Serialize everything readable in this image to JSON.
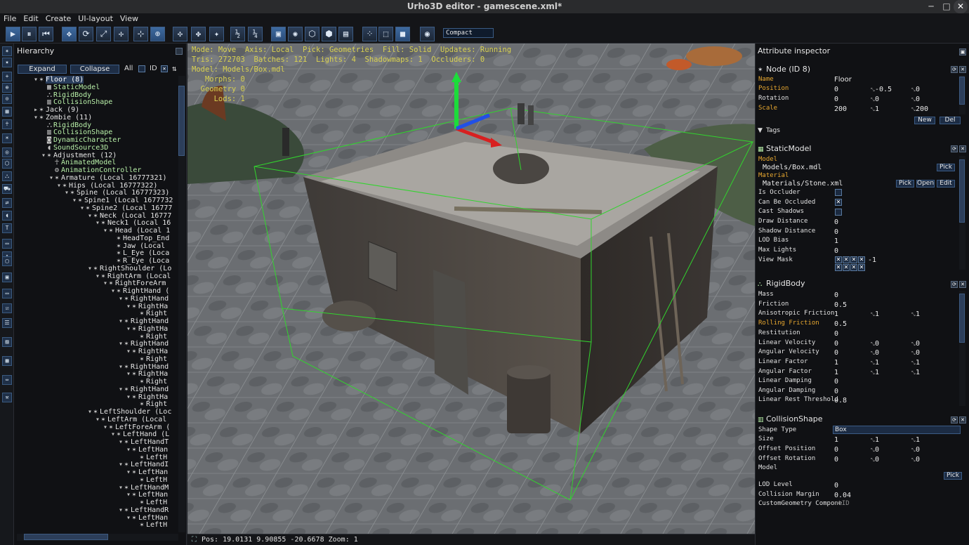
{
  "window": {
    "title": "Urho3D editor - gamescene.xml*"
  },
  "menu": [
    "File",
    "Edit",
    "Create",
    "UI-layout",
    "View"
  ],
  "toolbar": {
    "mode_select": "Compact",
    "buttons": [
      {
        "name": "play-icon",
        "glyph": "▶"
      },
      {
        "name": "pause-icon",
        "glyph": "⏸"
      },
      {
        "name": "rewind-icon",
        "glyph": "⏮"
      },
      {
        "name": "move-icon",
        "glyph": "✥"
      },
      {
        "name": "rotate-icon",
        "glyph": "⟳"
      },
      {
        "name": "scale-icon",
        "glyph": "⤢"
      },
      {
        "name": "select-icon",
        "glyph": "✢"
      },
      {
        "name": "local-axis-icon",
        "glyph": "⊹"
      },
      {
        "name": "world-axis-icon",
        "glyph": "⊕"
      },
      {
        "name": "snap-move-icon",
        "glyph": "✣"
      },
      {
        "name": "snap-rotate-icon",
        "glyph": "✤"
      },
      {
        "name": "snap-scale-icon",
        "glyph": "✦"
      },
      {
        "name": "snap-half-icon",
        "glyph": "½"
      },
      {
        "name": "snap-quarter-icon",
        "glyph": "¼"
      },
      {
        "name": "pick-geometry-icon",
        "glyph": "▣"
      },
      {
        "name": "pick-lights-icon",
        "glyph": "✺"
      },
      {
        "name": "pick-zones-icon",
        "glyph": "⬡"
      },
      {
        "name": "pick-rigidbodies-icon",
        "glyph": "⬢"
      },
      {
        "name": "pick-ui-icon",
        "glyph": "▤"
      },
      {
        "name": "fill-point-icon",
        "glyph": "⁘"
      },
      {
        "name": "fill-wireframe-icon",
        "glyph": "⬚"
      },
      {
        "name": "fill-solid-icon",
        "glyph": "■"
      },
      {
        "name": "camera-view-icon",
        "glyph": "◉"
      }
    ]
  },
  "leftbar_icons": [
    "node-icon",
    "component-icon",
    "new-node-icon",
    "new-replicated-icon",
    "new-local-icon",
    "geometry-icon",
    "animation-icon",
    "light-icon",
    "camera-icon",
    "zone-icon",
    "physics-icon",
    "navigation-icon",
    "network-icon",
    "audio-icon",
    "text-icon",
    "ui-icon",
    "scroll-icon",
    "button-icon",
    "window-icon",
    "lineedit-icon",
    "checkbox-icon",
    "list-icon",
    "sprite-icon",
    "border-icon",
    "slider-icon",
    "tool-icon"
  ],
  "hierarchy": {
    "title": "Hierarchy",
    "expand_label": "Expand",
    "collapse_label": "Collapse",
    "all_label": "All",
    "id_label": "ID",
    "rows": [
      {
        "indent": 4,
        "exp": "▼",
        "icon": "✶",
        "text": "Floor (8)",
        "comp": false,
        "sel": true
      },
      {
        "indent": 5,
        "exp": "",
        "icon": "▦",
        "text": "StaticModel",
        "comp": true
      },
      {
        "indent": 5,
        "exp": "",
        "icon": "⛬",
        "text": "RigidBody",
        "comp": true
      },
      {
        "indent": 5,
        "exp": "",
        "icon": "▥",
        "text": "CollisionShape",
        "comp": true
      },
      {
        "indent": 4,
        "exp": "▶",
        "icon": "✶",
        "text": "Jack (9)",
        "comp": false
      },
      {
        "indent": 4,
        "exp": "▼",
        "icon": "✶",
        "text": "Zombie (11)",
        "comp": false
      },
      {
        "indent": 5,
        "exp": "",
        "icon": "⛬",
        "text": "RigidBody",
        "comp": true
      },
      {
        "indent": 5,
        "exp": "",
        "icon": "▥",
        "text": "CollisionShape",
        "comp": true
      },
      {
        "indent": 5,
        "exp": "",
        "icon": "◙",
        "text": "DynamicCharacter",
        "comp": true
      },
      {
        "indent": 5,
        "exp": "",
        "icon": "◖",
        "text": "SoundSource3D",
        "comp": true
      },
      {
        "indent": 5,
        "exp": "▼",
        "icon": "✶",
        "text": "Adjustment (12)",
        "comp": false
      },
      {
        "indent": 6,
        "exp": "",
        "icon": "☥",
        "text": "AnimatedModel",
        "comp": true
      },
      {
        "indent": 6,
        "exp": "",
        "icon": "⚙",
        "text": "AnimationController",
        "comp": true
      },
      {
        "indent": 6,
        "exp": "▼",
        "icon": "✶",
        "text": "Armature (Local 16777321)",
        "comp": false
      },
      {
        "indent": 7,
        "exp": "▼",
        "icon": "✶",
        "text": "Hips (Local 16777322)",
        "comp": false
      },
      {
        "indent": 8,
        "exp": "▼",
        "icon": "✶",
        "text": "Spine (Local 16777323)",
        "comp": false
      },
      {
        "indent": 9,
        "exp": "▼",
        "icon": "✶",
        "text": "Spine1 (Local 1677732",
        "comp": false
      },
      {
        "indent": 10,
        "exp": "▼",
        "icon": "✶",
        "text": "Spine2 (Local 16777",
        "comp": false
      },
      {
        "indent": 11,
        "exp": "▼",
        "icon": "✶",
        "text": "Neck (Local 16777",
        "comp": false
      },
      {
        "indent": 12,
        "exp": "▼",
        "icon": "✶",
        "text": "Neck1 (Local 16",
        "comp": false
      },
      {
        "indent": 13,
        "exp": "▼",
        "icon": "✶",
        "text": "Head (Local 1",
        "comp": false
      },
      {
        "indent": 14,
        "exp": "",
        "icon": "✶",
        "text": "HeadTop_End",
        "comp": false
      },
      {
        "indent": 14,
        "exp": "",
        "icon": "✶",
        "text": "Jaw (Local",
        "comp": false
      },
      {
        "indent": 14,
        "exp": "",
        "icon": "✶",
        "text": "L_Eye (Loca",
        "comp": false
      },
      {
        "indent": 14,
        "exp": "",
        "icon": "✶",
        "text": "R_Eye (Loca",
        "comp": false
      },
      {
        "indent": 11,
        "exp": "▼",
        "icon": "✶",
        "text": "RightShoulder (Lo",
        "comp": false
      },
      {
        "indent": 12,
        "exp": "▼",
        "icon": "✶",
        "text": "RightArm (Local",
        "comp": false
      },
      {
        "indent": 13,
        "exp": "▼",
        "icon": "✶",
        "text": "RightForeArm",
        "comp": false
      },
      {
        "indent": 14,
        "exp": "▼",
        "icon": "✶",
        "text": "RightHand (",
        "comp": false
      },
      {
        "indent": 15,
        "exp": "▼",
        "icon": "✶",
        "text": "RightHand",
        "comp": false
      },
      {
        "indent": 16,
        "exp": "▼",
        "icon": "✶",
        "text": "RightHa",
        "comp": false
      },
      {
        "indent": 17,
        "exp": "",
        "icon": "✶",
        "text": "Right",
        "comp": false
      },
      {
        "indent": 15,
        "exp": "▼",
        "icon": "✶",
        "text": "RightHand",
        "comp": false
      },
      {
        "indent": 16,
        "exp": "▼",
        "icon": "✶",
        "text": "RightHa",
        "comp": false
      },
      {
        "indent": 17,
        "exp": "",
        "icon": "✶",
        "text": "Right",
        "comp": false
      },
      {
        "indent": 15,
        "exp": "▼",
        "icon": "✶",
        "text": "RightHand",
        "comp": false
      },
      {
        "indent": 16,
        "exp": "▼",
        "icon": "✶",
        "text": "RightHa",
        "comp": false
      },
      {
        "indent": 17,
        "exp": "",
        "icon": "✶",
        "text": "Right",
        "comp": false
      },
      {
        "indent": 15,
        "exp": "▼",
        "icon": "✶",
        "text": "RightHand",
        "comp": false
      },
      {
        "indent": 16,
        "exp": "▼",
        "icon": "✶",
        "text": "RightHa",
        "comp": false
      },
      {
        "indent": 17,
        "exp": "",
        "icon": "✶",
        "text": "Right",
        "comp": false
      },
      {
        "indent": 15,
        "exp": "▼",
        "icon": "✶",
        "text": "RightHand",
        "comp": false
      },
      {
        "indent": 16,
        "exp": "▼",
        "icon": "✶",
        "text": "RightHa",
        "comp": false
      },
      {
        "indent": 17,
        "exp": "",
        "icon": "✶",
        "text": "Right",
        "comp": false
      },
      {
        "indent": 11,
        "exp": "▼",
        "icon": "✶",
        "text": "LeftShoulder (Loc",
        "comp": false
      },
      {
        "indent": 12,
        "exp": "▼",
        "icon": "✶",
        "text": "LeftArm (Local",
        "comp": false
      },
      {
        "indent": 13,
        "exp": "▼",
        "icon": "✶",
        "text": "LeftForeArm (",
        "comp": false
      },
      {
        "indent": 14,
        "exp": "▼",
        "icon": "✶",
        "text": "LeftHand (L",
        "comp": false
      },
      {
        "indent": 15,
        "exp": "▼",
        "icon": "✶",
        "text": "LeftHandT",
        "comp": false
      },
      {
        "indent": 16,
        "exp": "▼",
        "icon": "✶",
        "text": "LeftHan",
        "comp": false
      },
      {
        "indent": 17,
        "exp": "",
        "icon": "✶",
        "text": "LeftH",
        "comp": false
      },
      {
        "indent": 15,
        "exp": "▼",
        "icon": "✶",
        "text": "LeftHandI",
        "comp": false
      },
      {
        "indent": 16,
        "exp": "▼",
        "icon": "✶",
        "text": "LeftHan",
        "comp": false
      },
      {
        "indent": 17,
        "exp": "",
        "icon": "✶",
        "text": "LeftH",
        "comp": false
      },
      {
        "indent": 15,
        "exp": "▼",
        "icon": "✶",
        "text": "LeftHandM",
        "comp": false
      },
      {
        "indent": 16,
        "exp": "▼",
        "icon": "✶",
        "text": "LeftHan",
        "comp": false
      },
      {
        "indent": 17,
        "exp": "",
        "icon": "✶",
        "text": "LeftH",
        "comp": false
      },
      {
        "indent": 15,
        "exp": "▼",
        "icon": "✶",
        "text": "LeftHandR",
        "comp": false
      },
      {
        "indent": 16,
        "exp": "▼",
        "icon": "✶",
        "text": "LeftHan",
        "comp": false
      },
      {
        "indent": 17,
        "exp": "",
        "icon": "✶",
        "text": "LeftH",
        "comp": false
      }
    ]
  },
  "viewport": {
    "stats_line1": "Mode: Move  Axis: Local  Pick: Geometries  Fill: Solid  Updates: Running",
    "stats_line2": "Tris: 272703  Batches: 121  Lights: 4  Shadowmaps: 1  Occluders: 0",
    "model_line": "Model: Models/Box.mdl",
    "morphs": "Morphs: 0",
    "geometry": "Geometry 0",
    "lods": "Lods: 1",
    "status": "Pos: 19.0131  9.90855  -20.6678 Zoom: 1"
  },
  "inspector": {
    "title": "Attribute inspector",
    "node": {
      "header": "Node (ID 8)",
      "name_label": "Name",
      "name_value": "Floor",
      "position_label": "Position",
      "position": [
        "0",
        "-0.5",
        "0"
      ],
      "rotation_label": "Rotation",
      "rotation": [
        "0",
        "0",
        "0"
      ],
      "scale_label": "Scale",
      "scale": [
        "200",
        "1",
        "200"
      ],
      "new_label": "New",
      "del_label": "Del",
      "tags_label": "Tags"
    },
    "static_model": {
      "header": "StaticModel",
      "model_label": "Model",
      "model_value": "Models/Box.mdl",
      "pick_label": "Pick",
      "material_label": "Material",
      "material_value": "Materials/Stone.xml",
      "open_label": "Open",
      "edit_label": "Edit",
      "is_occluder": "Is Occluder",
      "can_be_occluded": "Can Be Occluded",
      "cast_shadows": "Cast Shadows",
      "draw_distance": "Draw Distance",
      "draw_distance_value": "0",
      "shadow_distance": "Shadow Distance",
      "shadow_distance_value": "0",
      "lod_bias": "LOD Bias",
      "lod_bias_value": "1",
      "max_lights": "Max Lights",
      "max_lights_value": "0",
      "view_mask": "View Mask",
      "view_mask_value": "-1"
    },
    "rigid_body": {
      "header": "RigidBody",
      "mass": "Mass",
      "mass_value": "0",
      "friction": "Friction",
      "friction_value": "0.5",
      "aniso_friction": "Anisotropic Friction",
      "aniso_values": [
        "1",
        "1",
        "1"
      ],
      "rolling_friction": "Rolling Friction",
      "rolling_friction_value": "0.5",
      "restitution": "Restitution",
      "restitution_value": "0",
      "linear_velocity": "Linear Velocity",
      "linear_velocity_values": [
        "0",
        "0",
        "0"
      ],
      "angular_velocity": "Angular Velocity",
      "angular_velocity_values": [
        "0",
        "0",
        "0"
      ],
      "linear_factor": "Linear Factor",
      "linear_factor_values": [
        "1",
        "1",
        "1"
      ],
      "angular_factor": "Angular Factor",
      "angular_factor_values": [
        "1",
        "1",
        "1"
      ],
      "linear_damping": "Linear Damping",
      "linear_damping_value": "0",
      "angular_damping": "Angular Damping",
      "angular_damping_value": "0",
      "linear_rest": "Linear Rest Threshold",
      "linear_rest_value": "0.8"
    },
    "collision_shape": {
      "header": "CollisionShape",
      "shape_type": "Shape Type",
      "shape_type_value": "Box",
      "size": "Size",
      "size_values": [
        "1",
        "1",
        "1"
      ],
      "offset_position": "Offset Position",
      "offset_position_values": [
        "0",
        "0",
        "0"
      ],
      "offset_rotation": "Offset Rotation",
      "offset_rotation_values": [
        "0",
        "0",
        "0"
      ],
      "model": "Model",
      "pick_label": "Pick",
      "lod_level": "LOD Level",
      "lod_level_value": "0",
      "collision_margin": "Collision Margin",
      "collision_margin_value": "0.04",
      "custom_geometry": "CustomGeometry Compone",
      "custom_geometry_value": "ntID"
    }
  },
  "colors": {
    "accent": "#3b5b84",
    "highlight": "#e8a830",
    "wireframe": "#32d42e",
    "overlay_text": "#d8d050"
  }
}
